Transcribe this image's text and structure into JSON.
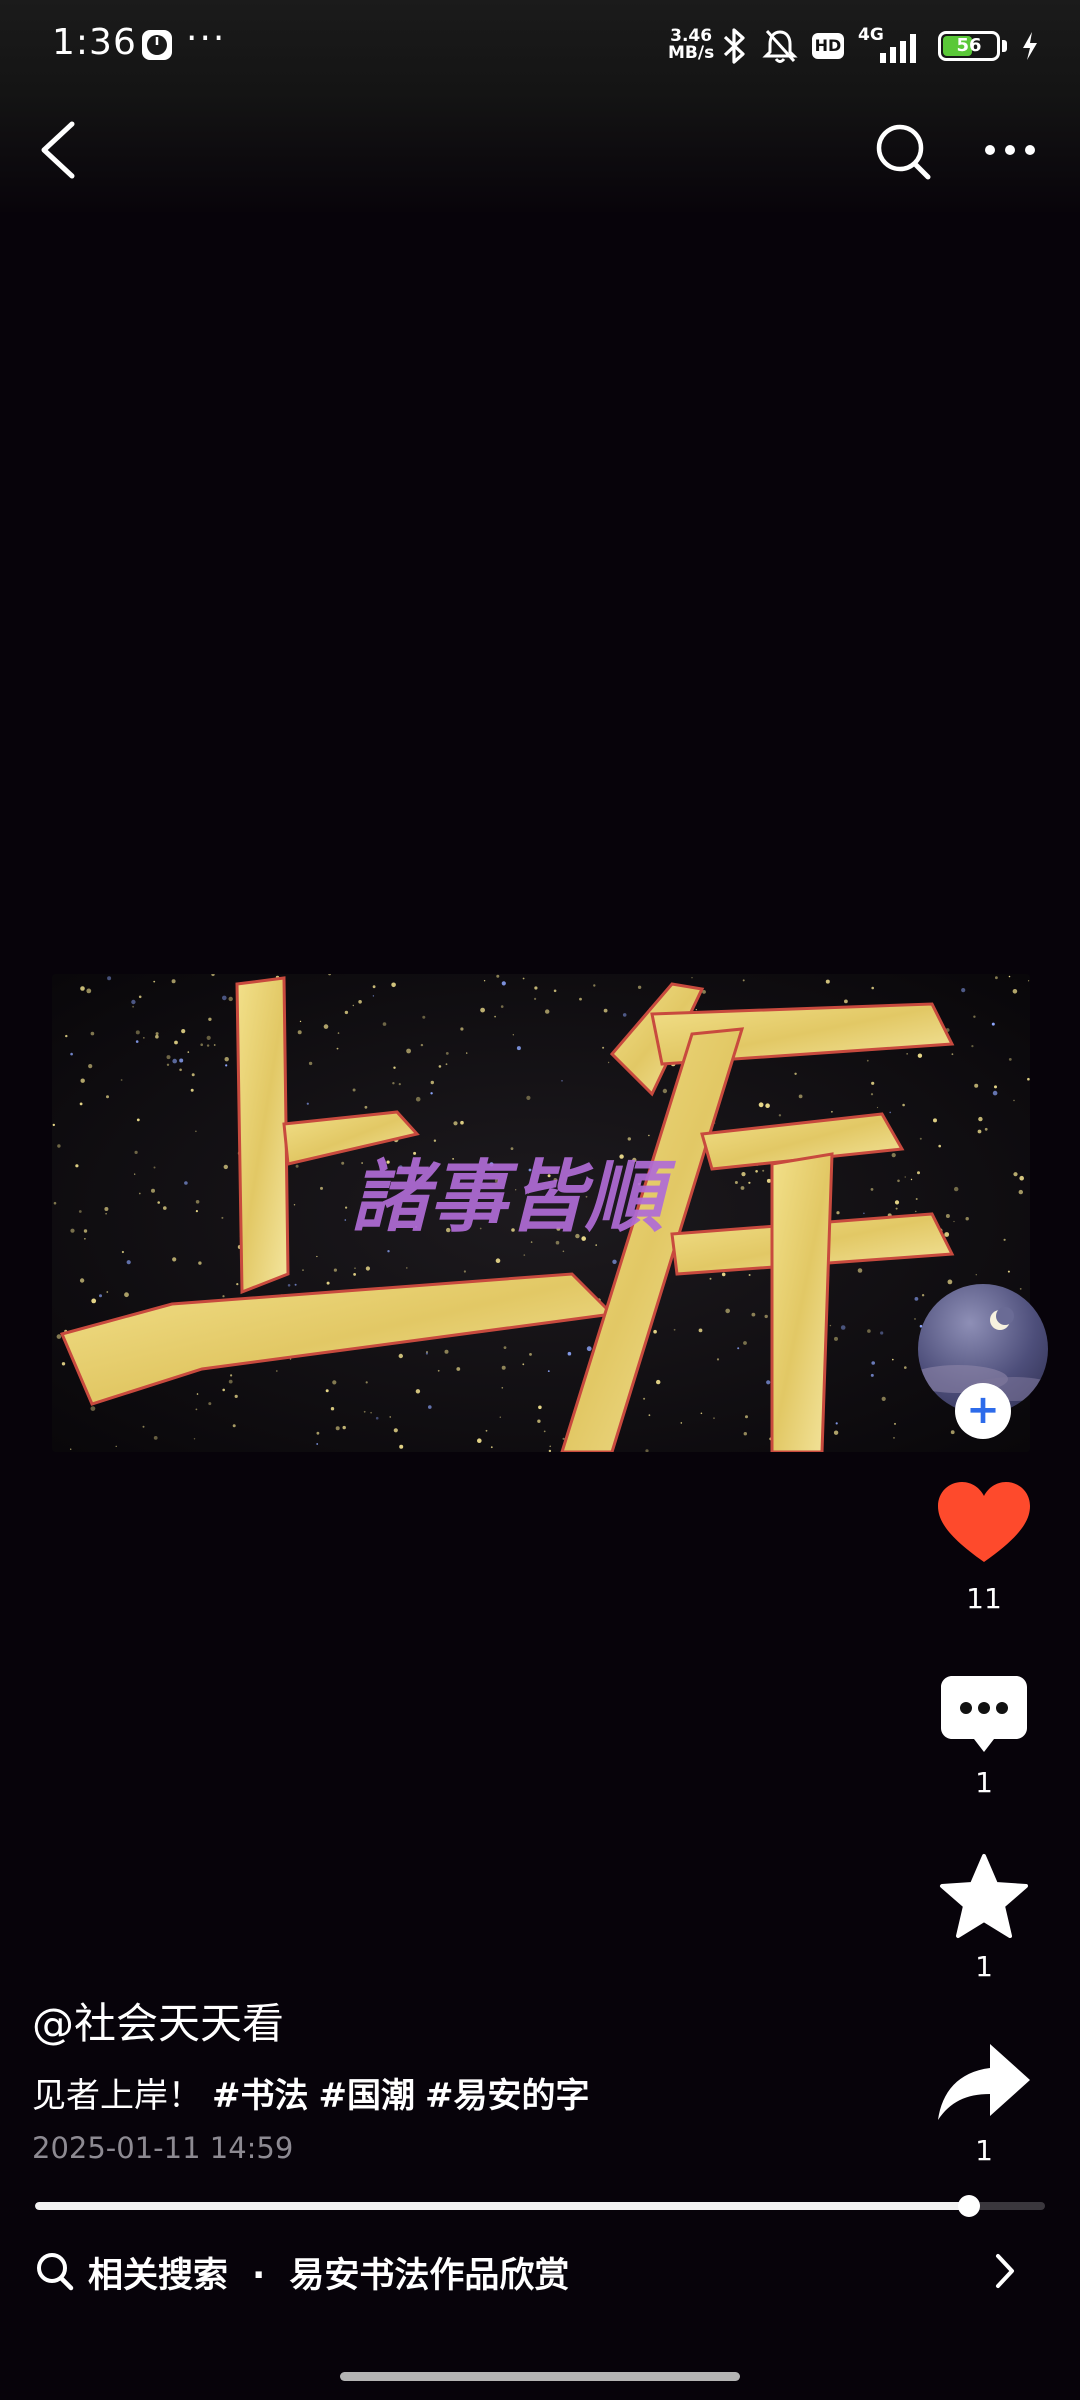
{
  "status_bar": {
    "time": "1:36",
    "dots": "···",
    "net_speed_value": "3.46",
    "net_speed_unit": "MB/s",
    "hd_label": "HD",
    "network_label": "4G",
    "battery_level": "56",
    "battery_fraction": 0.56,
    "icons": [
      "clock-icon",
      "bluetooth-icon",
      "bell-muted-icon",
      "hd-icon",
      "signal-icon",
      "battery-icon",
      "charging-icon"
    ]
  },
  "header": {
    "icons": [
      "back-icon",
      "search-icon",
      "more-icon"
    ]
  },
  "artwork": {
    "main_text": "上岸",
    "sub_text": "諸事皆順",
    "colors": {
      "background": "#0e0b10",
      "gold": "#e9d57a",
      "red": "#c84a3e",
      "sub": "#b06cd6"
    }
  },
  "right_rail": {
    "like_count": "11",
    "comment_count": "1",
    "favorite_count": "1",
    "share_count": "1",
    "follow_symbol": "+",
    "colors": {
      "like": "#fe4a2c",
      "follow": "#2d6bea"
    }
  },
  "caption": {
    "author": "@社会天天看",
    "text": "见者上岸！",
    "hashtags": [
      "#书法",
      "#国潮",
      "#易安的字"
    ],
    "time": "2025-01-11 14:59"
  },
  "playback": {
    "progress": 0.925
  },
  "related_search": {
    "label": "相关搜索",
    "separator": "·",
    "query": "易安书法作品欣赏"
  }
}
